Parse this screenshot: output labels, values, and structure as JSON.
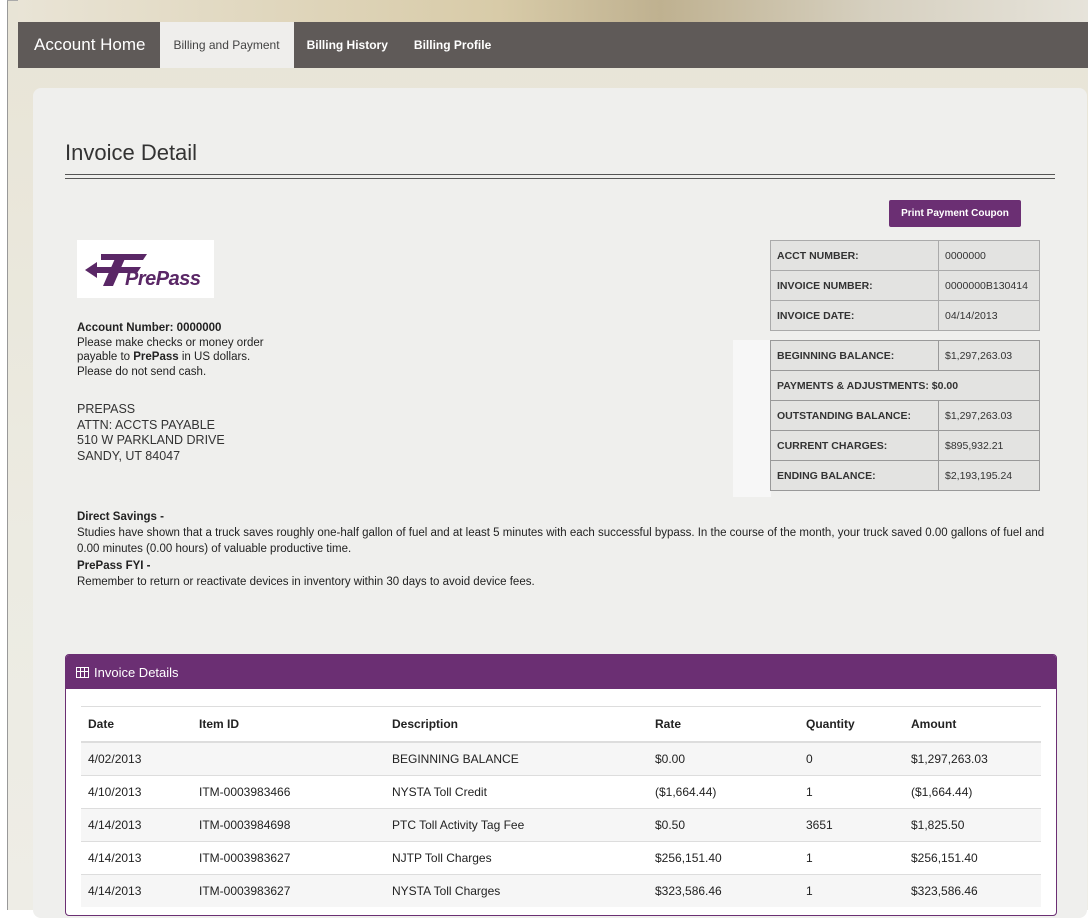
{
  "nav": {
    "home": "Account Home",
    "tabs": [
      {
        "label": "Billing and Payment",
        "active": true
      },
      {
        "label": "Billing History",
        "active": false
      },
      {
        "label": "Billing Profile",
        "active": false
      }
    ]
  },
  "page": {
    "title": "Invoice Detail",
    "print_button": "Print Payment Coupon"
  },
  "logo": {
    "text": "PrePass"
  },
  "payment_info": {
    "account_number_line": "Account Number: 0000000",
    "line1_pre": "Please make checks or money order",
    "line2_pre": "payable to ",
    "line2_bold": "PrePass",
    "line2_post": " in US dollars.",
    "line3": "Please do not send cash."
  },
  "address": {
    "line1": "PREPASS",
    "line2": "ATTN: ACCTS PAYABLE",
    "line3": "510 W PARKLAND DRIVE",
    "line4": "SANDY, UT 84047"
  },
  "account_summary": {
    "acct_number_label": "ACCT NUMBER:",
    "acct_number": "0000000",
    "invoice_number_label": "INVOICE NUMBER:",
    "invoice_number": "0000000B130414",
    "invoice_date_label": "INVOICE DATE:",
    "invoice_date": "04/14/2013"
  },
  "balances": {
    "beginning_label": "BEGINNING BALANCE:",
    "beginning": "$1,297,263.03",
    "payments_line": "PAYMENTS & ADJUSTMENTS: $0.00",
    "outstanding_label": "OUTSTANDING BALANCE:",
    "outstanding": "$1,297,263.03",
    "current_label": "CURRENT CHARGES:",
    "current": "$895,932.21",
    "ending_label": "ENDING BALANCE:",
    "ending": "$2,193,195.24"
  },
  "savings": {
    "heading": "Direct Savings -",
    "text": "Studies have shown that a truck saves roughly one-half gallon of fuel and at least 5 minutes with each successful bypass. In the course of the month, your truck saved 0.00 gallons of fuel and 0.00 minutes (0.00 hours) of valuable productive time."
  },
  "fyi": {
    "heading": "PrePass FYI -",
    "text": "Remember to return or reactivate devices in inventory within 30 days to avoid device fees."
  },
  "invoice_details": {
    "title": "Invoice Details",
    "columns": [
      "Date",
      "Item ID",
      "Description",
      "Rate",
      "Quantity",
      "Amount"
    ],
    "rows": [
      [
        "4/02/2013",
        "",
        "BEGINNING BALANCE",
        "$0.00",
        "0",
        "$1,297,263.03"
      ],
      [
        "4/10/2013",
        "ITM-0003983466",
        "NYSTA Toll Credit",
        "($1,664.44)",
        "1",
        "($1,664.44)"
      ],
      [
        "4/14/2013",
        "ITM-0003984698",
        "PTC Toll Activity Tag Fee",
        "$0.50",
        "3651",
        "$1,825.50"
      ],
      [
        "4/14/2013",
        "ITM-0003983627",
        "NJTP Toll Charges",
        "$256,151.40",
        "1",
        "$256,151.40"
      ],
      [
        "4/14/2013",
        "ITM-0003983627",
        "NYSTA Toll Charges",
        "$323,586.46",
        "1",
        "$323,586.46"
      ]
    ]
  },
  "colors": {
    "brand_purple": "#6b2f73",
    "nav_bg": "#5f5a58"
  }
}
